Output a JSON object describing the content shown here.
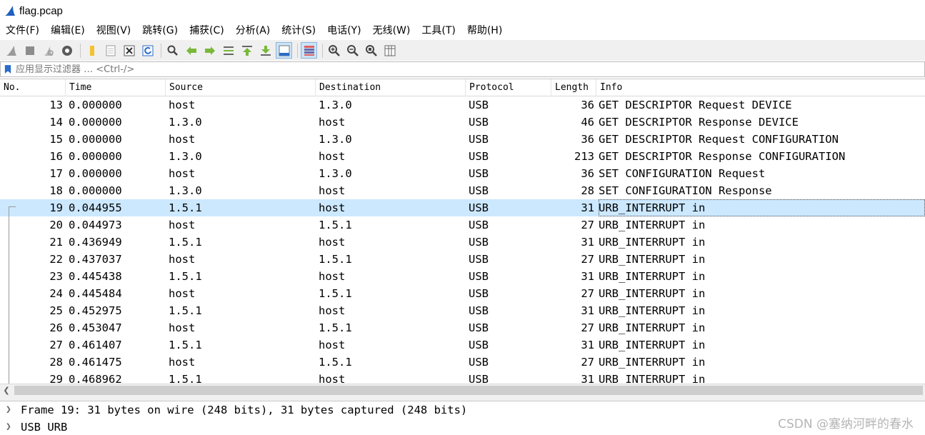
{
  "window": {
    "title": "flag.pcap"
  },
  "menu": [
    {
      "label": "文件(F)"
    },
    {
      "label": "编辑(E)"
    },
    {
      "label": "视图(V)"
    },
    {
      "label": "跳转(G)"
    },
    {
      "label": "捕获(C)"
    },
    {
      "label": "分析(A)"
    },
    {
      "label": "统计(S)"
    },
    {
      "label": "电话(Y)"
    },
    {
      "label": "无线(W)"
    },
    {
      "label": "工具(T)"
    },
    {
      "label": "帮助(H)"
    }
  ],
  "toolbar": {
    "icons": [
      "shark-fin-start-icon",
      "stop-icon",
      "restart-icon",
      "options-gear-icon",
      "open-folder-icon",
      "save-file-icon",
      "close-file-icon",
      "reload-icon",
      "find-icon",
      "back-arrow-icon",
      "forward-arrow-icon",
      "go-to-packet-icon",
      "first-packet-icon",
      "last-packet-icon",
      "auto-scroll-icon",
      "colorize-icon",
      "zoom-in-icon",
      "zoom-out-icon",
      "normal-size-icon",
      "resize-columns-icon"
    ]
  },
  "filter": {
    "placeholder": "应用显示过滤器 … <Ctrl-/>"
  },
  "columns": [
    {
      "label": "No."
    },
    {
      "label": "Time"
    },
    {
      "label": "Source"
    },
    {
      "label": "Destination"
    },
    {
      "label": "Protocol"
    },
    {
      "label": "Length"
    },
    {
      "label": "Info"
    }
  ],
  "packets": [
    {
      "no": "13",
      "time": "0.000000",
      "src": "host",
      "dst": "1.3.0",
      "proto": "USB",
      "len": "36",
      "info": "GET DESCRIPTOR Request DEVICE"
    },
    {
      "no": "14",
      "time": "0.000000",
      "src": "1.3.0",
      "dst": "host",
      "proto": "USB",
      "len": "46",
      "info": "GET DESCRIPTOR Response DEVICE"
    },
    {
      "no": "15",
      "time": "0.000000",
      "src": "host",
      "dst": "1.3.0",
      "proto": "USB",
      "len": "36",
      "info": "GET DESCRIPTOR Request CONFIGURATION"
    },
    {
      "no": "16",
      "time": "0.000000",
      "src": "1.3.0",
      "dst": "host",
      "proto": "USB",
      "len": "213",
      "info": "GET DESCRIPTOR Response CONFIGURATION"
    },
    {
      "no": "17",
      "time": "0.000000",
      "src": "host",
      "dst": "1.3.0",
      "proto": "USB",
      "len": "36",
      "info": "SET CONFIGURATION Request"
    },
    {
      "no": "18",
      "time": "0.000000",
      "src": "1.3.0",
      "dst": "host",
      "proto": "USB",
      "len": "28",
      "info": "SET CONFIGURATION Response"
    },
    {
      "no": "19",
      "time": "0.044955",
      "src": "1.5.1",
      "dst": "host",
      "proto": "USB",
      "len": "31",
      "info": "URB_INTERRUPT in"
    },
    {
      "no": "20",
      "time": "0.044973",
      "src": "host",
      "dst": "1.5.1",
      "proto": "USB",
      "len": "27",
      "info": "URB_INTERRUPT in"
    },
    {
      "no": "21",
      "time": "0.436949",
      "src": "1.5.1",
      "dst": "host",
      "proto": "USB",
      "len": "31",
      "info": "URB_INTERRUPT in"
    },
    {
      "no": "22",
      "time": "0.437037",
      "src": "host",
      "dst": "1.5.1",
      "proto": "USB",
      "len": "27",
      "info": "URB_INTERRUPT in"
    },
    {
      "no": "23",
      "time": "0.445438",
      "src": "1.5.1",
      "dst": "host",
      "proto": "USB",
      "len": "31",
      "info": "URB_INTERRUPT in"
    },
    {
      "no": "24",
      "time": "0.445484",
      "src": "host",
      "dst": "1.5.1",
      "proto": "USB",
      "len": "27",
      "info": "URB_INTERRUPT in"
    },
    {
      "no": "25",
      "time": "0.452975",
      "src": "1.5.1",
      "dst": "host",
      "proto": "USB",
      "len": "31",
      "info": "URB_INTERRUPT in"
    },
    {
      "no": "26",
      "time": "0.453047",
      "src": "host",
      "dst": "1.5.1",
      "proto": "USB",
      "len": "27",
      "info": "URB_INTERRUPT in"
    },
    {
      "no": "27",
      "time": "0.461407",
      "src": "1.5.1",
      "dst": "host",
      "proto": "USB",
      "len": "31",
      "info": "URB_INTERRUPT in"
    },
    {
      "no": "28",
      "time": "0.461475",
      "src": "host",
      "dst": "1.5.1",
      "proto": "USB",
      "len": "27",
      "info": "URB_INTERRUPT in"
    },
    {
      "no": "29",
      "time": "0.468962",
      "src": "1.5.1",
      "dst": "host",
      "proto": "USB",
      "len": "31",
      "info": "URB_INTERRUPT in"
    }
  ],
  "selected_packet": "19",
  "details": [
    {
      "text": "Frame 19: 31 bytes on wire (248 bits), 31 bytes captured (248 bits)"
    },
    {
      "text": "USB URB"
    }
  ],
  "watermark": "CSDN @塞纳河畔的春水",
  "colors": {
    "selected_row": "#cce8ff",
    "toolbar_bg": "#f0f0f0",
    "accent": "#1f5fbf"
  }
}
